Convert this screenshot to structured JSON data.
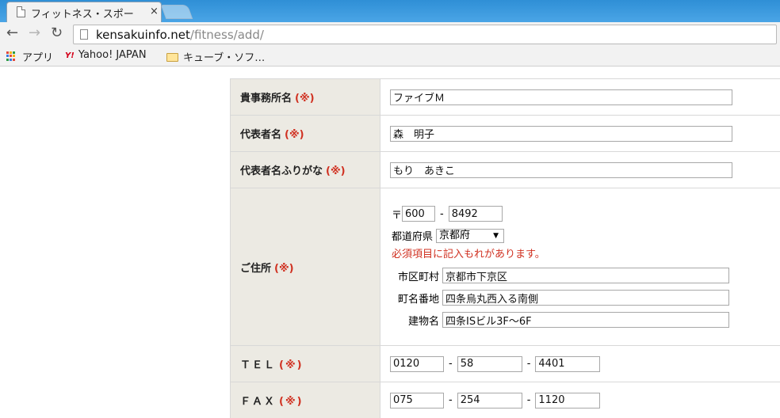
{
  "browser": {
    "tab_title": "フィットネス・スポー",
    "tab_close": "×",
    "url_host": "kensakuinfo.net",
    "url_path": "/fitness/add/",
    "bookmarks": {
      "apps": "アプリ",
      "yahoo_logo": "Y!",
      "yahoo": "Yahoo! JAPAN",
      "folder": "キューブ・ソフ…"
    }
  },
  "form": {
    "required_mark": "(※)",
    "office_name": {
      "label": "貴事務所名",
      "value": "ファイブＭ"
    },
    "representative": {
      "label": "代表者名",
      "value": "森　明子"
    },
    "representative_kana": {
      "label": "代表者名ふりがな",
      "value": "もり　あきこ"
    },
    "address": {
      "label": "ご住所",
      "postal_mark": "〒",
      "postal1": "600",
      "postal_dash": "-",
      "postal2": "8492",
      "prefecture_label": "都道府県",
      "prefecture_value": "京都府",
      "error": "必須項目に記入もれがあります。",
      "city_label": "市区町村",
      "city_value": "京都市下京区",
      "street_label": "町名番地",
      "street_value": "四条烏丸西入る南側",
      "building_label": "建物名",
      "building_value": "四条ISビル3F〜6F"
    },
    "tel": {
      "label": "ＴＥＬ",
      "part1": "0120",
      "part2": "58",
      "part3": "4401",
      "dash": "-"
    },
    "fax": {
      "label": "ＦＡＸ",
      "part1": "075",
      "part2": "254",
      "part3": "1120",
      "dash": "-"
    }
  },
  "colors": {
    "label_bg": "#eceae3",
    "required": "#d03020",
    "tab_strip": "#3a98dc"
  }
}
